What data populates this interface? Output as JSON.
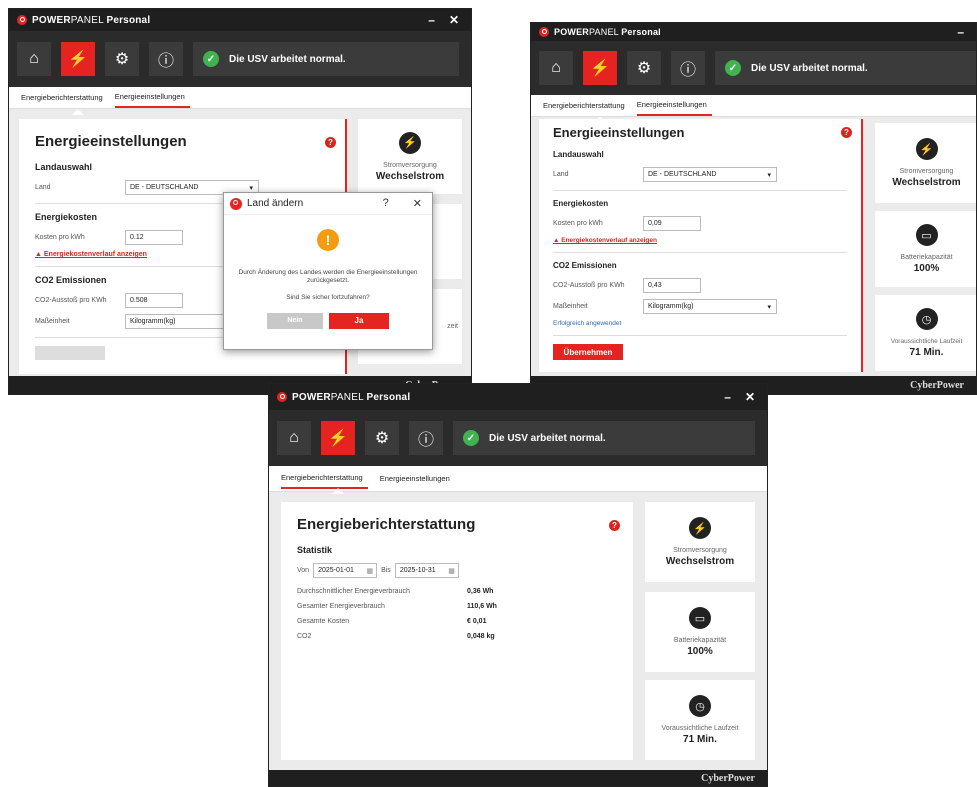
{
  "app": {
    "brand_a": "POWER",
    "brand_b": "PANEL",
    "brand_c": "Personal",
    "min": "–",
    "close": "✕",
    "footer_logo": "CyberPower"
  },
  "status": {
    "text": "Die USV arbeitet normal.",
    "check": "✓"
  },
  "nav": {
    "home_icon": "⌂",
    "energy_icon": "⚡",
    "settings_icon": "⚙",
    "info_icon": "ⓘ"
  },
  "tabs": {
    "report": "Energieberichterstattung",
    "settings": "Energieeinstellungen"
  },
  "settings": {
    "title": "Energieeinstellungen",
    "help": "?",
    "country_section": "Landauswahl",
    "country_label": "Land",
    "country_value": "DE - DEUTSCHLAND",
    "cost_section": "Energiekosten",
    "cost_label": "Kosten pro kWh",
    "cost_value_1": "0.12",
    "cost_value_2": "0,09",
    "cost_link": "▲ Energiekostenverlauf anzeigen",
    "co2_section": "CO2 Emissionen",
    "co2_label": "CO2-Ausstoß pro KWh",
    "co2_value_1": "0.508",
    "co2_value_2": "0,43",
    "unit_label": "Maßeinheit",
    "unit_value": "Kilogramm(kg)",
    "applied": "Erfolgreich angewendet",
    "apply_button": "Übernehmen"
  },
  "side": {
    "power_title": "Stromversorgung",
    "power_value": "Wechselstrom",
    "battery_title": "Batteriekapazität",
    "battery_value": "100%",
    "runtime_title": "Voraussichtliche Laufzeit",
    "runtime_value": "71 Min.",
    "runtime_partial": "zeit",
    "power_icon": "⚡",
    "battery_icon": "▭",
    "runtime_icon": "◷"
  },
  "dialog": {
    "title": "Land ändern",
    "help": "?",
    "close": "✕",
    "icon": "!",
    "message": "Durch Änderung des Landes werden die Energieeinstellungen zurückgesetzt.",
    "question": "Sind Sie sicher fortzufahren?",
    "no": "Nein",
    "yes": "Ja"
  },
  "report": {
    "title": "Energieberichterstattung",
    "help": "?",
    "section": "Statistik",
    "from_label": "Von",
    "from_value": "2025-01-01",
    "to_label": "Bis",
    "to_value": "2025-10-31",
    "cal_icon": "▦",
    "rows": [
      {
        "k": "Durchschnittlicher Energieverbrauch",
        "v": "0,36 Wh"
      },
      {
        "k": "Gesamter Energieverbrauch",
        "v": "110,6 Wh"
      },
      {
        "k": "Gesamte Kosten",
        "v": "€ 0,01"
      },
      {
        "k": "CO2",
        "v": "0,048 kg"
      }
    ]
  }
}
